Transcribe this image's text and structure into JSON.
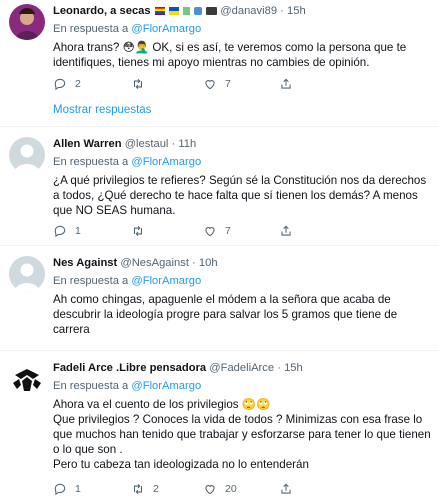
{
  "tweets": [
    {
      "name": "Leonardo, a secas",
      "badges": "🏳️‍🌈🇺🇦🧃🎶📻",
      "handle": "@danavi89",
      "dot": "·",
      "time": "15h",
      "reply_prefix": "En respuesta a ",
      "reply_to": "@FlorAmargo",
      "text": [
        "Ahora trans? 😳🤦‍♂️ OK, si es así, te veremos como la persona que te identifiques, tienes mi apoyo mientras no cambies de opinión."
      ],
      "replies": "2",
      "retweets": "",
      "likes": "7",
      "show_more": "Mostrar respuestas"
    },
    {
      "name": "Allen Warren",
      "handle": "@lestaul",
      "dot": "·",
      "time": "11h",
      "reply_prefix": "En respuesta a ",
      "reply_to": "@FlorAmargo",
      "text": [
        "¿A qué privilegios te refieres? Según sé la Constitución nos da derechos a todos, ¿Qué derecho te hace falta que sí tienen los demás? A menos que NO SEAS humana."
      ],
      "replies": "1",
      "retweets": "",
      "likes": "7"
    },
    {
      "name": "Nes Against",
      "handle": "@NesAgainst",
      "dot": "·",
      "time": "10h",
      "reply_prefix": "En respuesta a ",
      "reply_to": "@FlorAmargo",
      "text": [
        "Ah como chingas, apaguenle el módem a la señora que acaba de descubrir la ideología progre para salvar los 5 gramos que tiene de carrera"
      ],
      "replies": "1",
      "retweets": "",
      "likes": "7"
    },
    {
      "name": "Fadeli Arce .Libre pensadora",
      "handle": "@FadeliArce",
      "dot": "·",
      "time": "15h",
      "reply_prefix": "En respuesta a ",
      "reply_to": "@FlorAmargo",
      "text": [
        "Ahora va el cuento  de los privilegios 🙄🙄",
        "Que privilegios ? Conoces la vida de todos ? Minimizas con esa frase lo que muchos han tenido que trabajar y esforzarse para tener lo que tienen o lo que son .",
        "Pero tu cabeza tan ideologizada no lo entenderán"
      ],
      "replies": "1",
      "retweets": "2",
      "likes": "20"
    }
  ]
}
